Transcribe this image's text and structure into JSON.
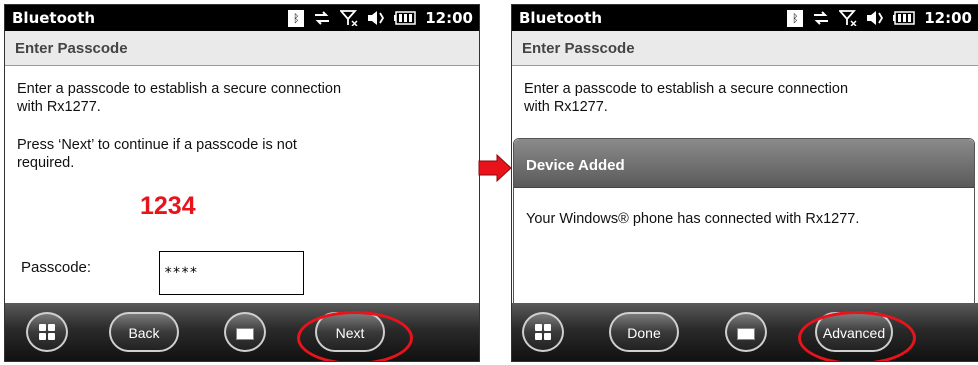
{
  "left": {
    "status": {
      "app": "Bluetooth",
      "time": "12:00"
    },
    "title": "Enter Passcode",
    "intro": "Enter a passcode to establish a secure connection with Rx1277.",
    "hint": "Press ‘Next’ to continue if a passcode is not required.",
    "code": "1234",
    "passcode_label": "Passcode:",
    "passcode_value": "****",
    "softkeys": {
      "back": "Back",
      "next": "Next"
    }
  },
  "right": {
    "status": {
      "app": "Bluetooth",
      "time": "12:00"
    },
    "title": "Enter Passcode",
    "intro": "Enter a passcode to establish a secure connection with Rx1277.",
    "dialog": {
      "title": "Device Added",
      "message": "Your Windows® phone has connected with Rx1277."
    },
    "softkeys": {
      "done": "Done",
      "advanced": "Advanced"
    }
  },
  "colors": {
    "highlight": "#e8131b",
    "arrow": "#e8131b"
  }
}
